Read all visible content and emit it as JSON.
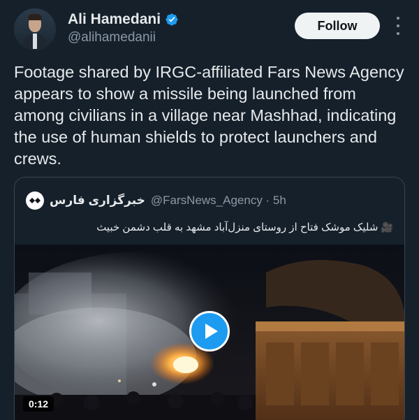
{
  "author": {
    "display_name": "Ali Hamedani",
    "handle": "@alihamedanii",
    "verified": true
  },
  "follow_label": "Follow",
  "tweet_text": "Footage shared by IRGC-affiliated Fars News Agency appears to show a missile being launched from among civilians in a village near Mashhad, indicating the use of human shields to protect launchers and crews.",
  "quote": {
    "name": "خبرگزاری فارس",
    "handle_time": "@FarsNews_Agency · 5h",
    "text": "شلیک موشک فتاح از روستای منزل‌آباد مشهد به قلب دشمن خبیث",
    "video_icon": "🎥",
    "media": {
      "duration": "0:12",
      "play_icon": "play-icon"
    }
  },
  "colors": {
    "background": "#15202b",
    "accent": "#1d9bf0",
    "border": "#38444d",
    "muted_text": "#8b98a5"
  }
}
